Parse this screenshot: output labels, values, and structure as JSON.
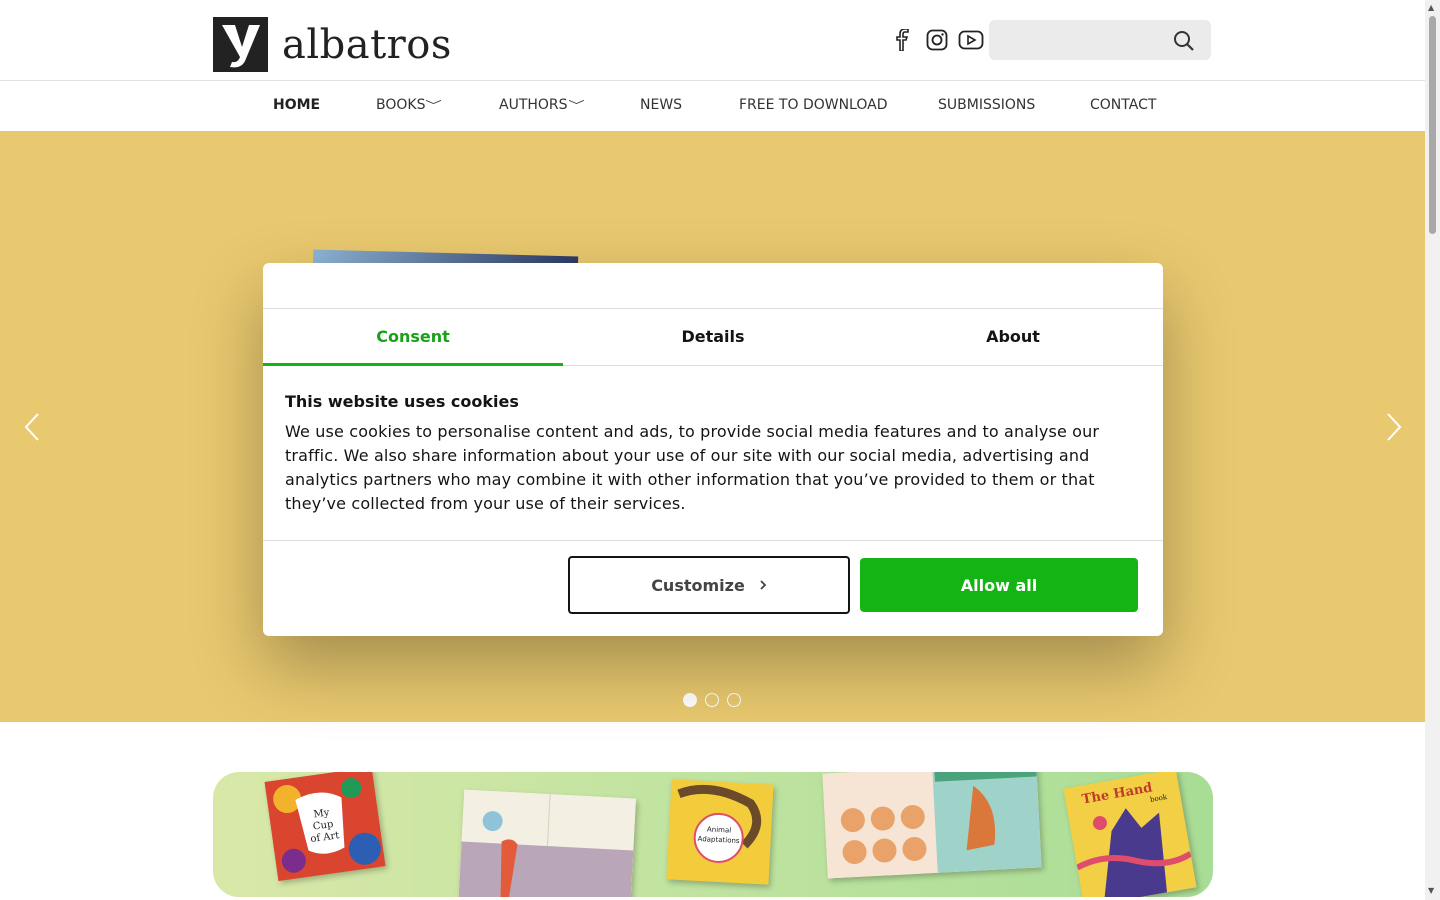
{
  "header": {
    "logo_text": "albatros",
    "social_icons": [
      "facebook-icon",
      "instagram-icon",
      "youtube-icon"
    ],
    "search": {
      "placeholder": "",
      "icon": "search-icon"
    }
  },
  "nav": {
    "items": [
      {
        "label": "HOME",
        "active": true,
        "dropdown": false
      },
      {
        "label": "BOOKS",
        "active": false,
        "dropdown": true
      },
      {
        "label": "AUTHORS",
        "active": false,
        "dropdown": true
      },
      {
        "label": "NEWS",
        "active": false,
        "dropdown": false
      },
      {
        "label": "FREE TO DOWNLOAD",
        "active": false,
        "dropdown": false
      },
      {
        "label": "SUBMISSIONS",
        "active": false,
        "dropdown": false
      },
      {
        "label": "CONTACT",
        "active": false,
        "dropdown": false
      }
    ],
    "caret": "﹀"
  },
  "hero": {
    "background": "#e9c96f",
    "slides_total": 3,
    "active_slide": 1
  },
  "banner": {
    "books": [
      {
        "title": "My Cup of Art"
      },
      {
        "title": ""
      },
      {
        "title": "Animal Adaptations"
      },
      {
        "title": ""
      },
      {
        "title": "The Hand book"
      }
    ]
  },
  "cookie_dialog": {
    "tabs": [
      {
        "label": "Consent",
        "active": true
      },
      {
        "label": "Details",
        "active": false
      },
      {
        "label": "About",
        "active": false
      }
    ],
    "title": "This website uses cookies",
    "body": "We use cookies to personalise content and ads, to provide social media features and to analyse our traffic. We also share information about your use of our site with our social media, advertising and analytics partners who may combine it with other information that you’ve provided to them or that they’ve collected from your use of their services.",
    "customize_label": "Customize",
    "allow_all_label": "Allow all",
    "accent": "#15b415"
  }
}
